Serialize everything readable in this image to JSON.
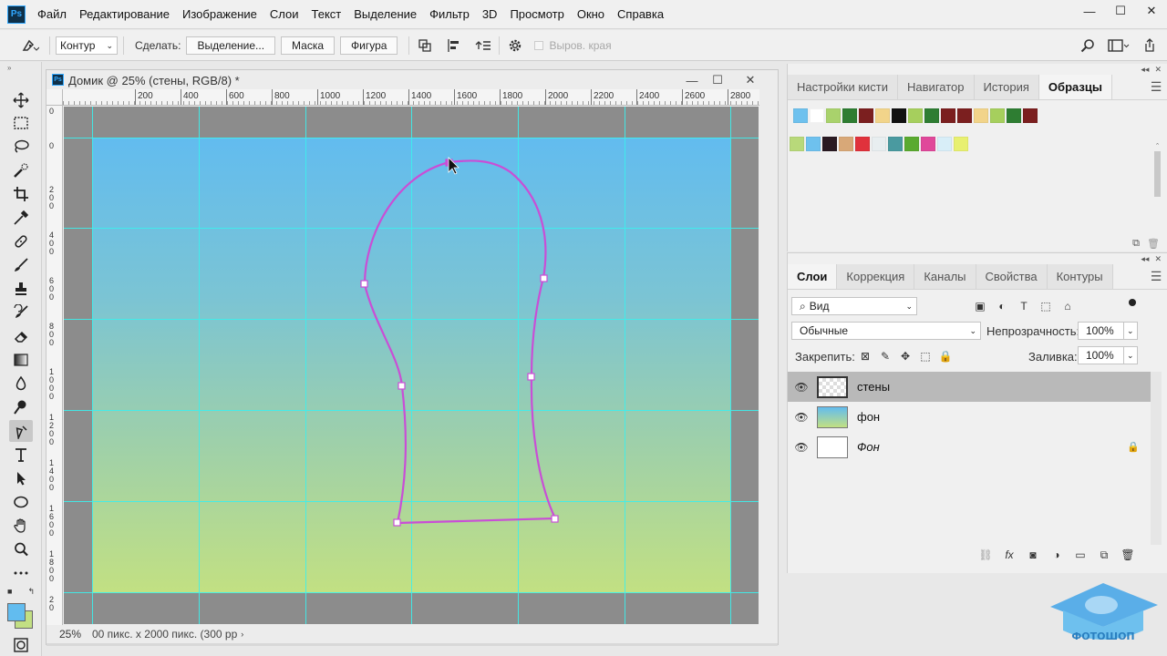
{
  "app": {
    "logo": "Ps"
  },
  "menu": [
    "Файл",
    "Редактирование",
    "Изображение",
    "Слои",
    "Текст",
    "Выделение",
    "Фильтр",
    "3D",
    "Просмотр",
    "Окно",
    "Справка"
  ],
  "window_controls": {
    "minimize": "—",
    "maximize": "☐",
    "close": "✕"
  },
  "options": {
    "mode_value": "Контур",
    "make_label": "Сделать:",
    "selection_button": "Выделение...",
    "mask_button": "Маска",
    "shape_button": "Фигура",
    "align_edges_label": "Выров. края"
  },
  "document": {
    "title": "Домик @ 25% (стены, RGB/8) *",
    "zoom": "25%",
    "info": "00 пикс. x 2000 пикс. (300 рр"
  },
  "ruler": {
    "h_labels": [
      "200",
      "400",
      "600",
      "800",
      "1000",
      "1200",
      "1400",
      "1600",
      "1800",
      "2000",
      "2200",
      "2400",
      "2600",
      "2800"
    ],
    "v_labels": [
      "0",
      "0",
      "2\n0\n0",
      "4\n0\n0",
      "6\n0\n0",
      "8\n0\n0",
      "1\n0\n0\n0",
      "1\n2\n0\n0",
      "1\n4\n0\n0",
      "1\n6\n0\n0",
      "1\n8\n0\n0",
      "2\n0"
    ]
  },
  "swatches_panel": {
    "tabs": [
      "Настройки кисти",
      "Навигатор",
      "История",
      "Образцы"
    ],
    "active_tab": "Образцы",
    "row1": [
      "#6ec1ee",
      "#ffffff",
      "#a9d26c",
      "#2e7d32",
      "#7b1f1f",
      "#f2d48a",
      "#111111",
      "#a6cf5d",
      "#2e7d32",
      "#7b1f1f",
      "#7b1f1f",
      "#f2d48a",
      "#a6cf5d",
      "#2e7d32",
      "#7b1f1f"
    ],
    "row2": [
      "#b8d97a",
      "#6ec1ee",
      "#2a1a22",
      "#d8a878",
      "#e0323c",
      "#e8eef0",
      "#4a9aa0",
      "#5aaa30",
      "#e0489a",
      "#d8eef8",
      "#e8f070"
    ]
  },
  "layers_panel": {
    "tabs": [
      "Слои",
      "Коррекция",
      "Каналы",
      "Свойства",
      "Контуры"
    ],
    "active_tab": "Слои",
    "filter_placeholder": "Вид",
    "blend_mode": "Обычные",
    "opacity_label": "Непрозрачность:",
    "opacity_value": "100%",
    "lock_label": "Закрепить:",
    "fill_label": "Заливка:",
    "fill_value": "100%",
    "layers": [
      {
        "name": "стены",
        "selected": true,
        "thumb": "transparent"
      },
      {
        "name": "фон",
        "selected": false,
        "thumb": "gradient"
      },
      {
        "name": "Фон",
        "selected": false,
        "thumb": "white",
        "locked": true
      }
    ]
  },
  "watermark": {
    "text": "ФОТОШОП"
  }
}
